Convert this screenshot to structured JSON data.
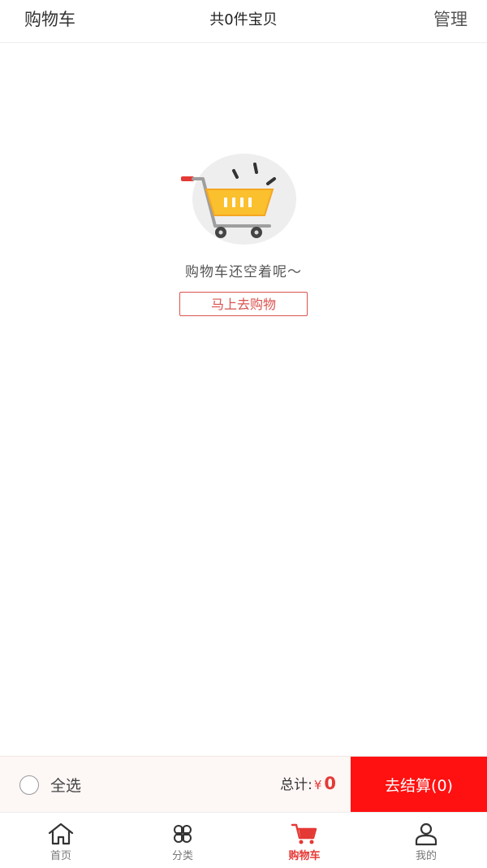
{
  "header": {
    "title": "购物车",
    "item_count_text": "共0件宝贝",
    "manage_label": "管理"
  },
  "empty_state": {
    "message": "购物车还空着呢～",
    "go_shopping_label": "马上去购物",
    "illustration_icon": "shopping-cart-icon"
  },
  "checkout": {
    "select_all_label": "全选",
    "total_label": "总计:",
    "currency": "¥",
    "total_amount": "0",
    "checkout_label": "去结算(0)",
    "accent_color": "#ff1111"
  },
  "tabbar": {
    "tabs": [
      {
        "label": "首页",
        "icon": "home-icon"
      },
      {
        "label": "分类",
        "icon": "category-icon"
      },
      {
        "label": "购物车",
        "icon": "cart-icon",
        "active": true
      },
      {
        "label": "我的",
        "icon": "user-icon"
      }
    ],
    "active_color": "#e53935"
  }
}
